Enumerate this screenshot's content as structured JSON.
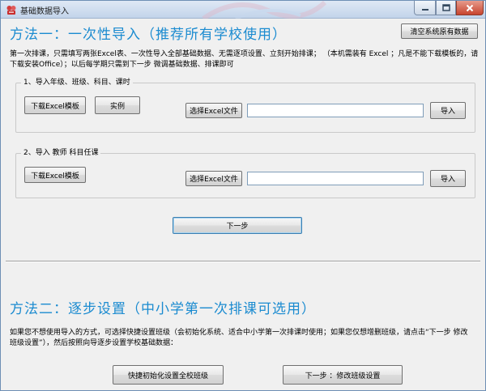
{
  "window": {
    "title": "基础数据导入"
  },
  "colors": {
    "heading": "#1b8bd0",
    "titlebar": "#c2d4ea",
    "close_button": "#c7442e",
    "background": "#f0f0f0"
  },
  "header": {
    "method1_title": "方法一：一次性导入（推荐所有学校使用）",
    "clear_button": "清空系统原有数据"
  },
  "method1": {
    "description_line1": "第一次排课，只需填写两张Excel表、一次性导入全部基础数据、无需逐项设置、立刻开始排课；  （本机需装有 Excel ；凡是不能下载模板的，请",
    "description_line2": "下载安装Office）；以后每学期只需到下一步 微调基础数据、排课即可",
    "group1": {
      "legend": "1、导入年级、班级、科目、课时",
      "download_button": "下载Excel模板",
      "example_button": "实例",
      "select_file_button": "选择Excel文件",
      "file_path": "",
      "import_button": "导入"
    },
    "group2": {
      "legend": "2、导入 教师 科目任课",
      "download_button": "下载Excel模板",
      "select_file_button": "选择Excel文件",
      "file_path": "",
      "import_button": "导入"
    },
    "next_button": "下一步"
  },
  "method2": {
    "title": "方法二：逐步设置（中小学第一次排课可选用）",
    "description_line1": "如果您不想使用导入的方式，可选择快捷设置班级（会初始化系统、适合中小学第一次排课时使用；如果您仅想增删班级，请点击“下一步 修改",
    "description_line2": "班级设置”），然后按照向导逐步设置学校基础数据：",
    "quick_setup_button": "快捷初始化设置全校班级",
    "modify_class_button": "下一步 ：修改班级设置"
  }
}
